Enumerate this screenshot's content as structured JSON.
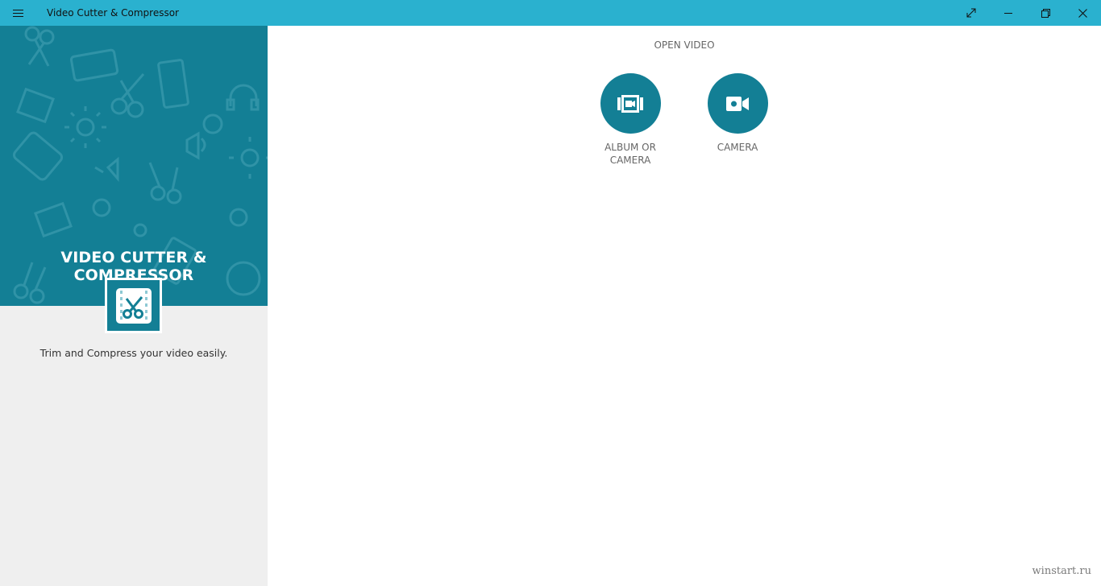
{
  "window": {
    "title": "Video Cutter & Compressor",
    "accent_color": "#2ab1cf",
    "controls": [
      "expand-icon",
      "minimize-icon",
      "restore-icon",
      "close-icon"
    ]
  },
  "sidebar": {
    "hero_title": "VIDEO CUTTER & COMPRESSOR",
    "tagline": "Trim and Compress your video easily.",
    "hero_color": "#137f95",
    "logo_icon": "scissors-film-icon"
  },
  "main": {
    "section_label": "OPEN VIDEO",
    "actions": [
      {
        "label": "ALBUM OR CAMERA",
        "icon": "video-album-icon"
      },
      {
        "label": "CAMERA",
        "icon": "video-camera-icon"
      }
    ]
  },
  "watermark": "winstart.ru"
}
